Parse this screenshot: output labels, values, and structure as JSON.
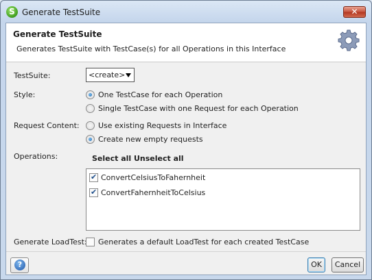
{
  "window": {
    "title": "Generate TestSuite",
    "app_icon_letter": "S",
    "close_glyph": "✕"
  },
  "header": {
    "title": "Generate TestSuite",
    "description": "Generates TestSuite with TestCase(s) for all Operations in this Interface",
    "icon": "gear-icon"
  },
  "form": {
    "testsuite": {
      "label": "TestSuite:",
      "value": "<create>"
    },
    "style": {
      "label": "Style:",
      "options": [
        {
          "label": "One TestCase for each Operation",
          "selected": true
        },
        {
          "label": "Single TestCase with one Request for each Operation",
          "selected": false
        }
      ]
    },
    "request_content": {
      "label": "Request Content:",
      "options": [
        {
          "label": "Use existing Requests in Interface",
          "selected": false
        },
        {
          "label": "Create new empty requests",
          "selected": true
        }
      ]
    },
    "operations": {
      "label": "Operations:",
      "select_all": "Select all",
      "unselect_all": "Unselect all",
      "items": [
        {
          "label": "ConvertCelsiusToFahernheit",
          "checked": true
        },
        {
          "label": "ConvertFahernheitToCelsius",
          "checked": true
        }
      ]
    },
    "loadtest": {
      "label": "Generate LoadTest:",
      "checkbox_label": "Generates a default LoadTest for each created TestCase",
      "checked": false
    }
  },
  "footer": {
    "help_glyph": "?",
    "ok_label": "OK",
    "cancel_label": "Cancel"
  }
}
